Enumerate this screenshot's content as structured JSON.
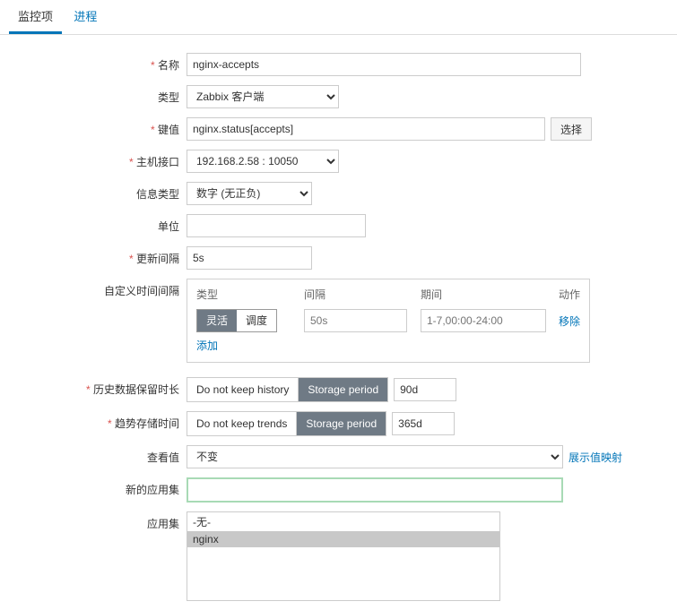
{
  "tabs": {
    "monitor": "监控项",
    "process": "进程"
  },
  "form": {
    "name_label": "名称",
    "name_value": "nginx-accepts",
    "type_label": "类型",
    "type_value": "Zabbix 客户端",
    "key_label": "键值",
    "key_value": "nginx.status[accepts]",
    "select_btn": "选择",
    "host_label": "主机接口",
    "host_value": "192.168.2.58 : 10050",
    "info_label": "信息类型",
    "info_value": "数字 (无正负)",
    "unit_label": "单位",
    "unit_value": "",
    "update_label": "更新间隔",
    "update_value": "5s",
    "custom_label": "自定义时间间隔",
    "custom": {
      "h_type": "类型",
      "h_interval": "间隔",
      "h_period": "期间",
      "h_action": "动作",
      "seg_flex": "灵活",
      "seg_sched": "调度",
      "interval_ph": "50s",
      "period_ph": "1-7,00:00-24:00",
      "remove": "移除",
      "add": "添加"
    },
    "history_label": "历史数据保留时长",
    "history_opt1": "Do not keep history",
    "history_opt2": "Storage period",
    "history_value": "90d",
    "trend_label": "趋势存储时间",
    "trend_opt1": "Do not keep trends",
    "trend_opt2": "Storage period",
    "trend_value": "365d",
    "view_label": "查看值",
    "view_value": "不变",
    "view_link": "展示值映射",
    "newapp_label": "新的应用集",
    "newapp_value": "",
    "app_label": "应用集",
    "app_none": "-无-",
    "app_nginx": "nginx"
  }
}
